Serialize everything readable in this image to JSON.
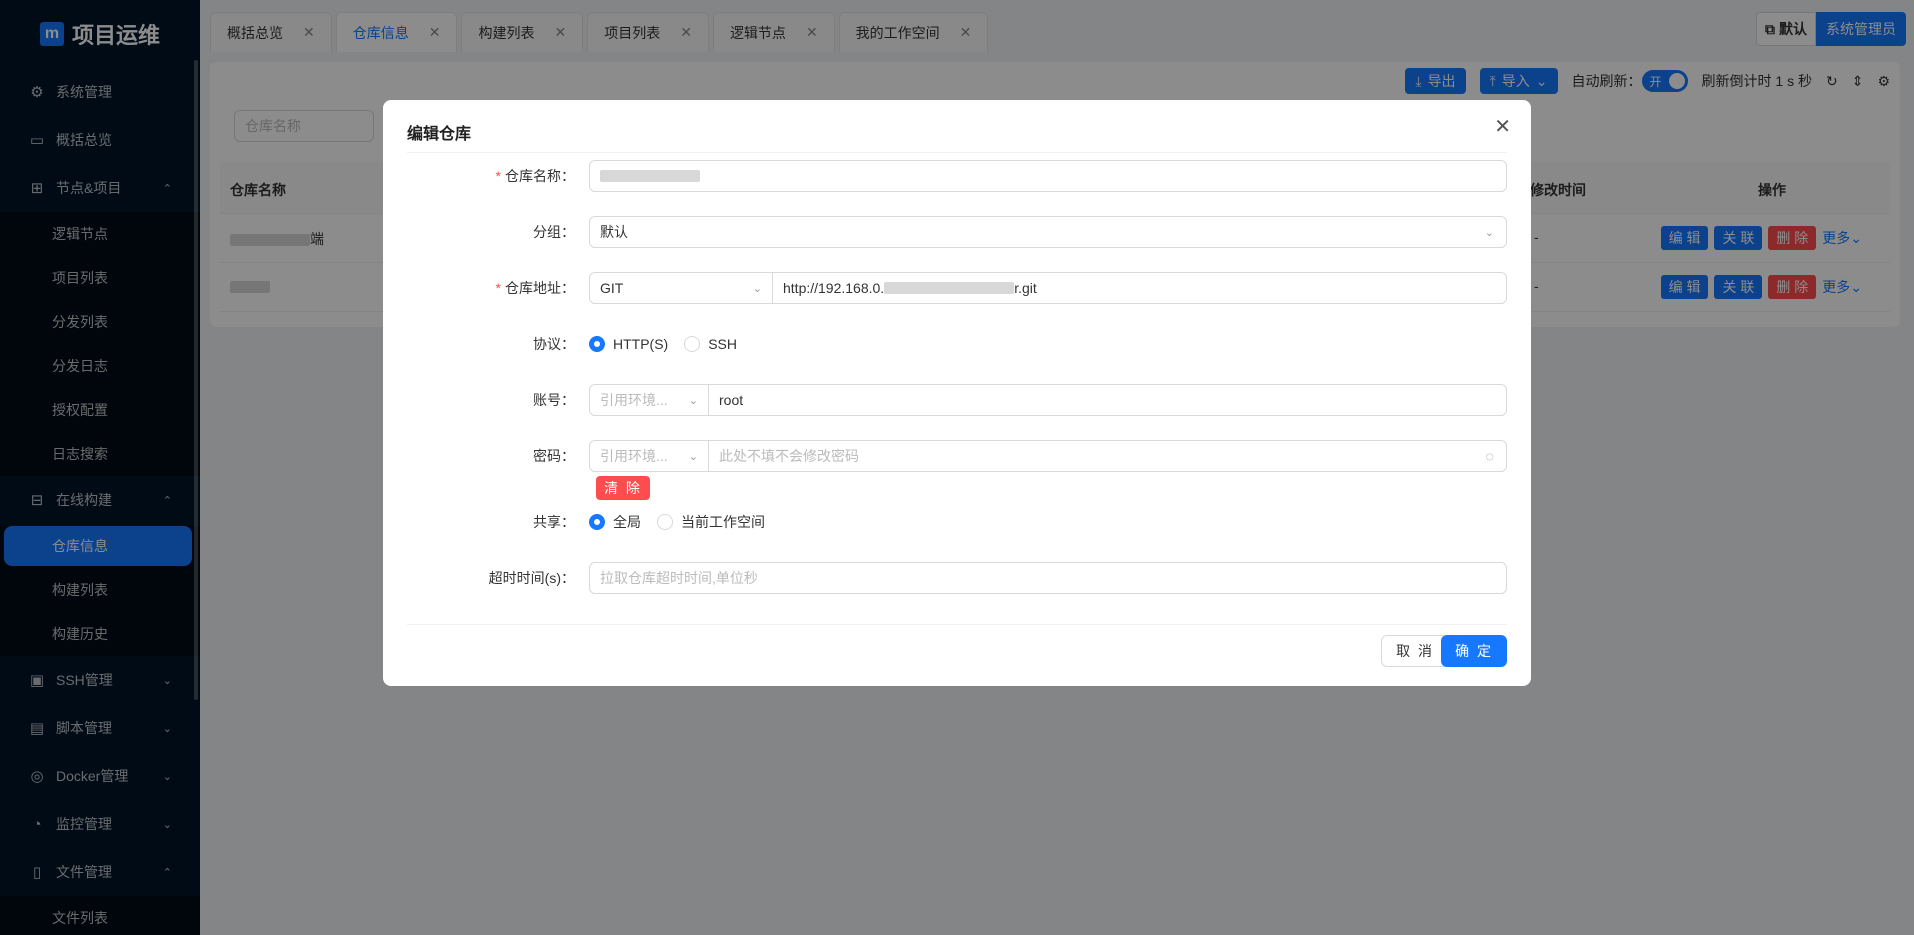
{
  "app": {
    "title": "项目运维",
    "logo_glyph": "m"
  },
  "sidebar": {
    "items": [
      {
        "label": "系统管理",
        "icon": "⚙"
      },
      {
        "label": "概括总览",
        "icon": "▭"
      },
      {
        "label": "节点&项目",
        "icon": "⊞",
        "caret": "⌃"
      }
    ],
    "node_children": [
      "逻辑节点",
      "项目列表",
      "分发列表",
      "分发日志",
      "授权配置",
      "日志搜索"
    ],
    "build_group": {
      "label": "在线构建",
      "icon": "⊟",
      "caret": "⌃"
    },
    "build_children": [
      "仓库信息",
      "构建列表",
      "构建历史"
    ],
    "lower_items": [
      {
        "label": "SSH管理",
        "icon": "▣",
        "caret": "⌄"
      },
      {
        "label": "脚本管理",
        "icon": "▤",
        "caret": "⌄"
      },
      {
        "label": "Docker管理",
        "icon": "◎",
        "caret": "⌄"
      },
      {
        "label": "监控管理",
        "icon": "◔",
        "caret": "⌄"
      },
      {
        "label": "文件管理",
        "icon": "▯",
        "caret": "⌃"
      }
    ],
    "file_children": [
      "文件列表"
    ]
  },
  "tabs": [
    {
      "label": "概括总览",
      "active": false
    },
    {
      "label": "仓库信息",
      "active": true
    },
    {
      "label": "构建列表",
      "active": false
    },
    {
      "label": "项目列表",
      "active": false
    },
    {
      "label": "逻辑节点",
      "active": false
    },
    {
      "label": "我的工作空间",
      "active": false
    }
  ],
  "tab_close": "✕",
  "header_right": {
    "workspace": "默认",
    "user": "系统管理员"
  },
  "toolbar": {
    "export": "导出",
    "import": "导入",
    "auto_refresh_label": "自动刷新：",
    "switch_text": "开",
    "countdown": "刷新倒计时 1 s 秒"
  },
  "table": {
    "search_placeholder": "仓库名称",
    "col_name": "仓库名称",
    "col_modified": "修改时间",
    "col_ops": "操作",
    "rows": [
      {
        "name_suffix": "端",
        "modified": "-"
      },
      {
        "name_suffix": "",
        "modified": "-"
      }
    ],
    "op_edit": "编 辑",
    "op_link": "关 联",
    "op_delete": "删 除",
    "op_more": "更多"
  },
  "modal": {
    "title": "编辑仓库",
    "close": "✕",
    "fields": {
      "name_label": "仓库名称：",
      "group_label": "分组：",
      "group_value": "默认",
      "address_label": "仓库地址：",
      "repo_type": "GIT",
      "repo_url_prefix": "http://192.168.0.",
      "repo_url_suffix": "r.git",
      "protocol_label": "协议：",
      "protocol_options": [
        "HTTP(S)",
        "SSH"
      ],
      "protocol_selected": "HTTP(S)",
      "account_label": "账号：",
      "account_env_placeholder": "引用环境...",
      "account_value": "root",
      "password_label": "密码：",
      "password_env_placeholder": "引用环境...",
      "password_placeholder": "此处不填不会修改密码",
      "clear_button": "清 除",
      "share_label": "共享：",
      "share_options": [
        "全局",
        "当前工作空间"
      ],
      "share_selected": "全局",
      "timeout_label": "超时时间(s)：",
      "timeout_placeholder": "拉取仓库超时时间,单位秒"
    },
    "cancel": "取 消",
    "ok": "确 定"
  },
  "colors": {
    "primary": "#1677ff",
    "danger": "#ff4d4f",
    "sidebar_bg": "#001529"
  }
}
